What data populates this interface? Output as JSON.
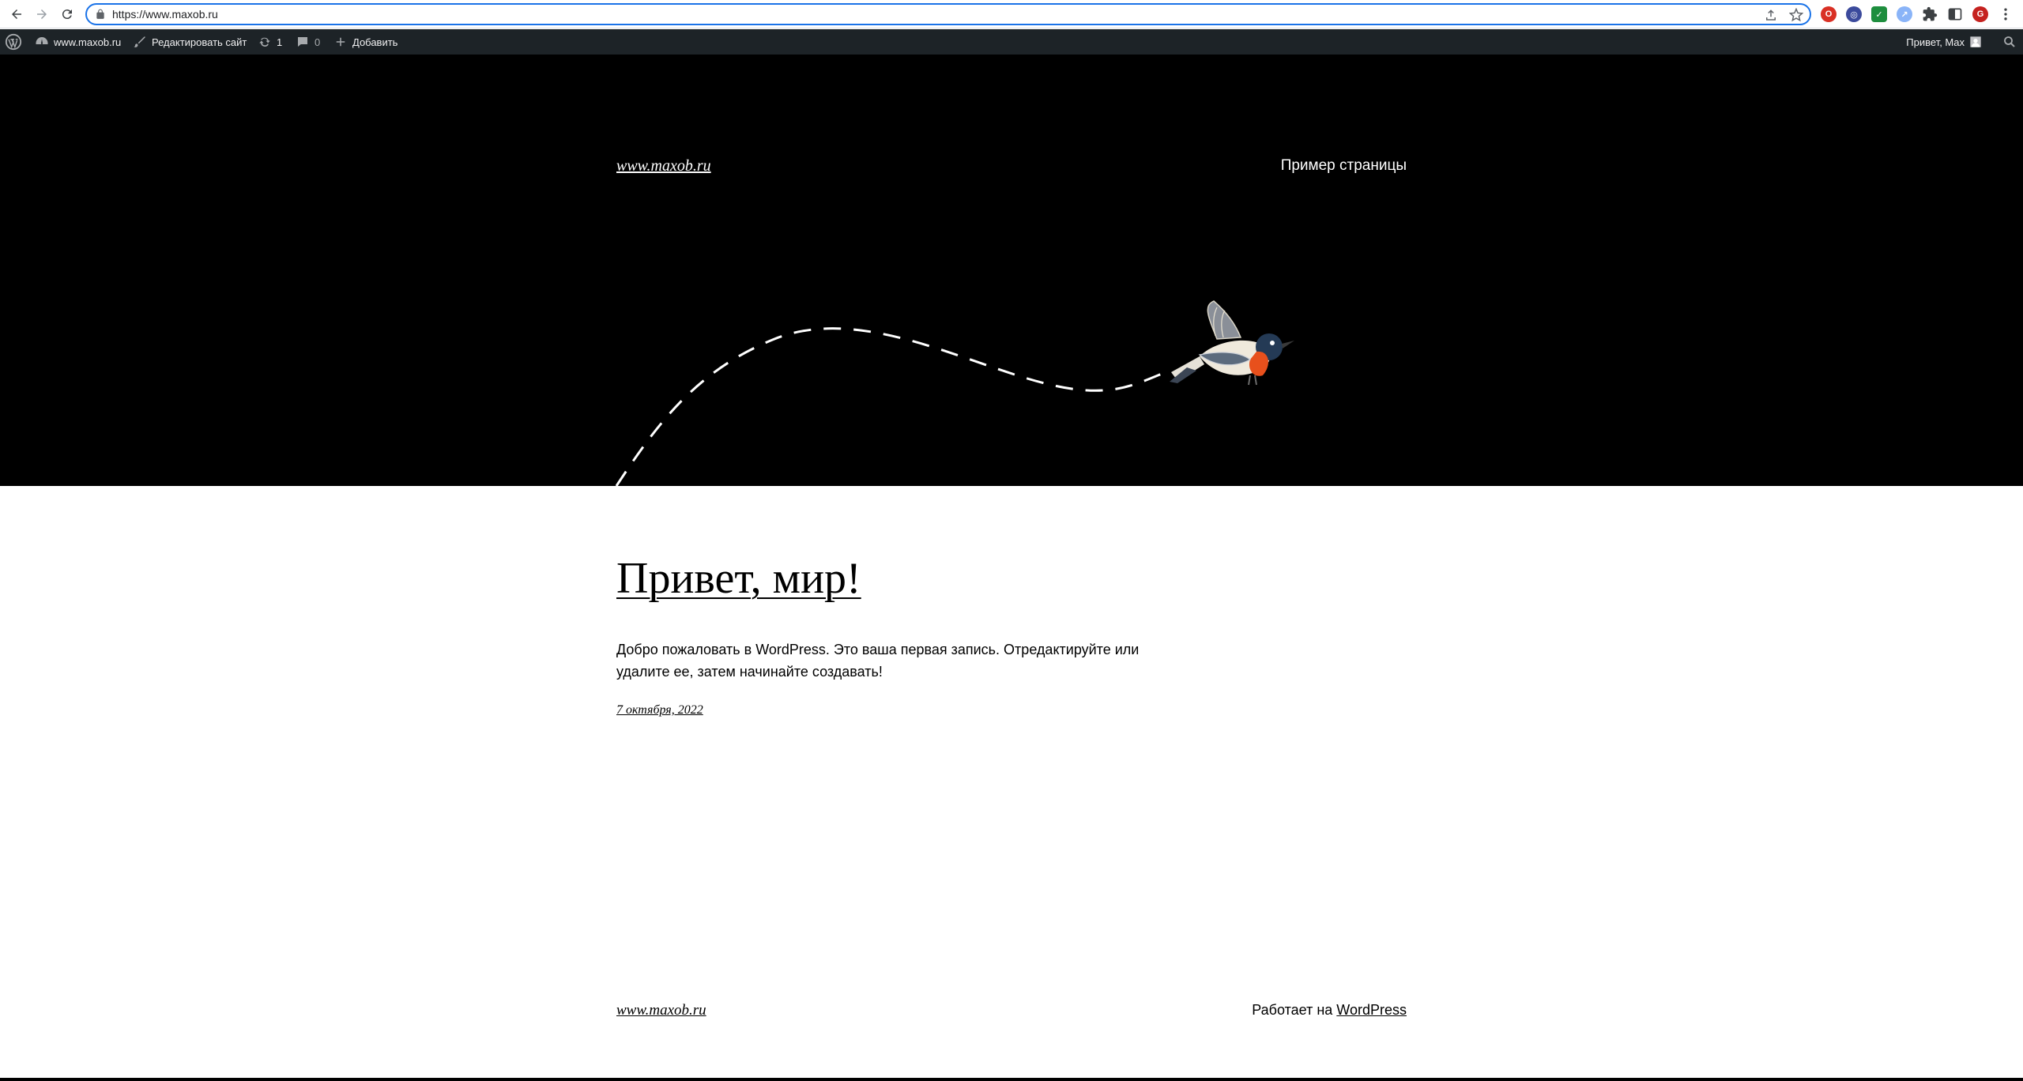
{
  "browser": {
    "url": "https://www.maxob.ru",
    "profile_initial": "G",
    "colors": {
      "omnibox_focus": "#1a73e8",
      "profile": "#c5221f"
    }
  },
  "adminbar": {
    "site_name": "www.maxob.ru",
    "edit_site": "Редактировать сайт",
    "updates_count": "1",
    "comments_count": "0",
    "new_label": "Добавить",
    "greeting": "Привет, Max"
  },
  "header": {
    "site_title": "www.maxob.ru",
    "nav_item": "Пример страницы"
  },
  "post": {
    "title": "Привет, мир!",
    "body": "Добро пожаловать в WordPress. Это ваша первая запись. Отредактируйте или удалите ее, затем начинайте создавать!",
    "date": "7 октября, 2022"
  },
  "footer": {
    "site_title": "www.maxob.ru",
    "credit_prefix": "Работает на",
    "credit_link": "WordPress"
  },
  "icons": [
    "back-icon",
    "forward-icon",
    "reload-icon",
    "lock-icon",
    "share-icon",
    "bookmark-star-icon",
    "extension-icon",
    "puzzle-icon",
    "sidepanel-icon",
    "menu-dots-icon",
    "wordpress-logo-icon",
    "dashboard-icon",
    "brush-icon",
    "updates-icon",
    "comments-icon",
    "plus-icon",
    "avatar-icon",
    "search-icon",
    "bird-illustration"
  ]
}
